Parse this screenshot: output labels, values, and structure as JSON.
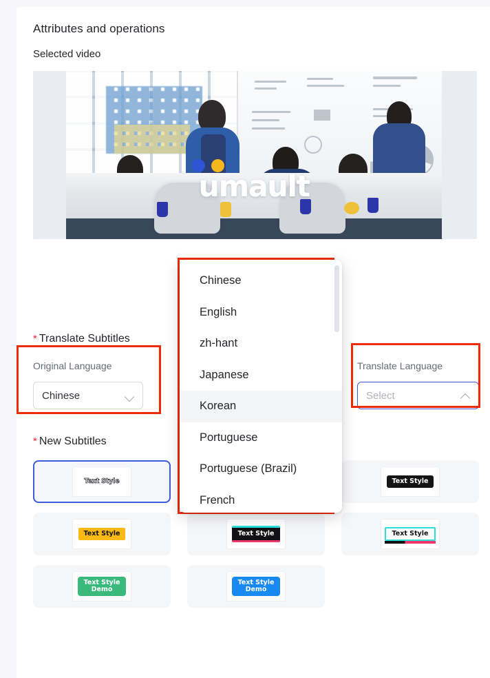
{
  "page": {
    "section_title": "Attributes and operations",
    "selected_video_label": "Selected video",
    "bg_color": "#f7f7fb",
    "card_color": "#ffffff",
    "accent_color": "#3b5bdb",
    "annotation_color": "#ef2b06",
    "required_mark": "*"
  },
  "video": {
    "logo_text": "umault",
    "dot1_color": "#2f55d4",
    "dot2_color": "#f5b81c",
    "alt": "office meeting room with five colleagues around a conference table and a whiteboard"
  },
  "translate_subtitles": {
    "title": "Translate Subtitles",
    "original": {
      "label": "Original Language",
      "value": "Chinese",
      "chevron": "chevron-down-icon"
    },
    "target": {
      "label": "Translate Language",
      "value": "",
      "placeholder": "Select",
      "chevron": "chevron-up-icon"
    }
  },
  "new_subtitles": {
    "title": "New Subtitles",
    "styles": [
      {
        "name": "outline",
        "text": "Text Style",
        "chip_class": "chip-outline",
        "selected": true
      },
      {
        "name": "plain",
        "text": "",
        "chip_class": "chip-empty",
        "selected": false
      },
      {
        "name": "black-box",
        "text": "Text Style",
        "chip_class": "chip-black",
        "selected": false
      },
      {
        "name": "yellow-box",
        "text": "Text Style",
        "chip_class": "chip-yellow",
        "selected": false
      },
      {
        "name": "glitch-dark",
        "text": "Text Style",
        "chip_class": "chip-glitch",
        "selected": false
      },
      {
        "name": "glitch-light",
        "text": "Text Style",
        "chip_class": "chip-glitch-light",
        "selected": false
      },
      {
        "name": "green-demo",
        "text": "Text Style\nDemo",
        "chip_class": "chip-green",
        "selected": false
      },
      {
        "name": "blue-demo",
        "text": "Text Style\nDemo",
        "chip_class": "chip-blue",
        "selected": false
      }
    ]
  },
  "language_dropdown": {
    "visible": true,
    "highlighted": "Korean",
    "options": [
      "Chinese",
      "English",
      "zh-hant",
      "Japanese",
      "Korean",
      "Portuguese",
      "Portuguese (Brazil)",
      "French"
    ]
  }
}
